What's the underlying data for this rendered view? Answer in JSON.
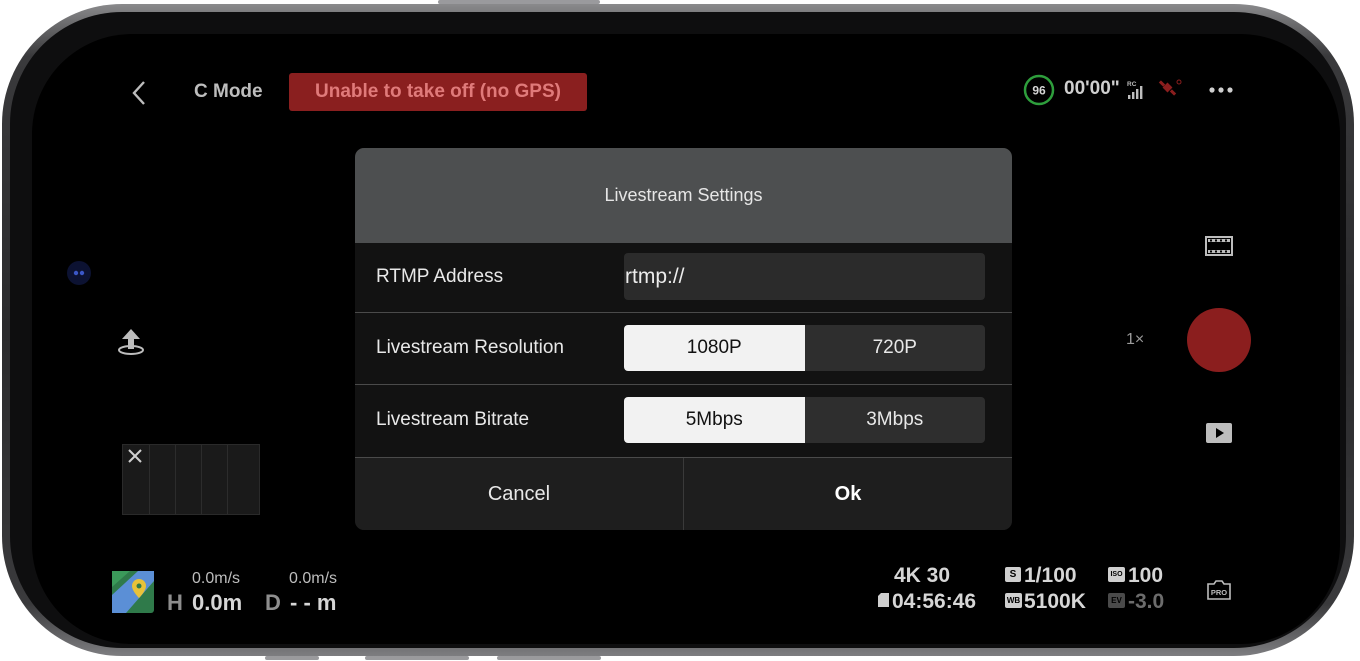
{
  "top_bar": {
    "mode": "C Mode",
    "warning": "Unable to take off (no GPS)",
    "battery": "96",
    "flight_time": "00'00\"",
    "rc_label": "RC"
  },
  "side": {
    "zoom": "1×"
  },
  "telemetry": {
    "horizontal_speed": "0.0m/s",
    "vertical_speed": "0.0m/s",
    "height_letter": "H",
    "height_value": "0.0m",
    "distance_letter": "D",
    "distance_value": "- - m"
  },
  "camera": {
    "resolution": "4K 30",
    "remaining_time": "04:56:46",
    "shutter_badge": "S",
    "shutter": "1/100",
    "wb_badge": "WB",
    "white_balance": "5100K",
    "iso_badge": "ISO",
    "iso": "100",
    "ev_badge": "EV",
    "ev": "-3.0",
    "pro_label": "PRO"
  },
  "dialog": {
    "title": "Livestream Settings",
    "rtmp_label": "RTMP Address",
    "rtmp_value": "rtmp://",
    "resolution_label": "Livestream Resolution",
    "resolution_options": [
      "1080P",
      "720P"
    ],
    "resolution_selected": "1080P",
    "bitrate_label": "Livestream Bitrate",
    "bitrate_options": [
      "5Mbps",
      "3Mbps"
    ],
    "bitrate_selected": "5Mbps",
    "cancel_label": "Cancel",
    "ok_label": "Ok"
  },
  "colors": {
    "warning_bg": "#8a1f1f",
    "record": "#8b1e1e",
    "battery_ring": "#2e9e3c",
    "dialog_header": "#4d4f50"
  }
}
